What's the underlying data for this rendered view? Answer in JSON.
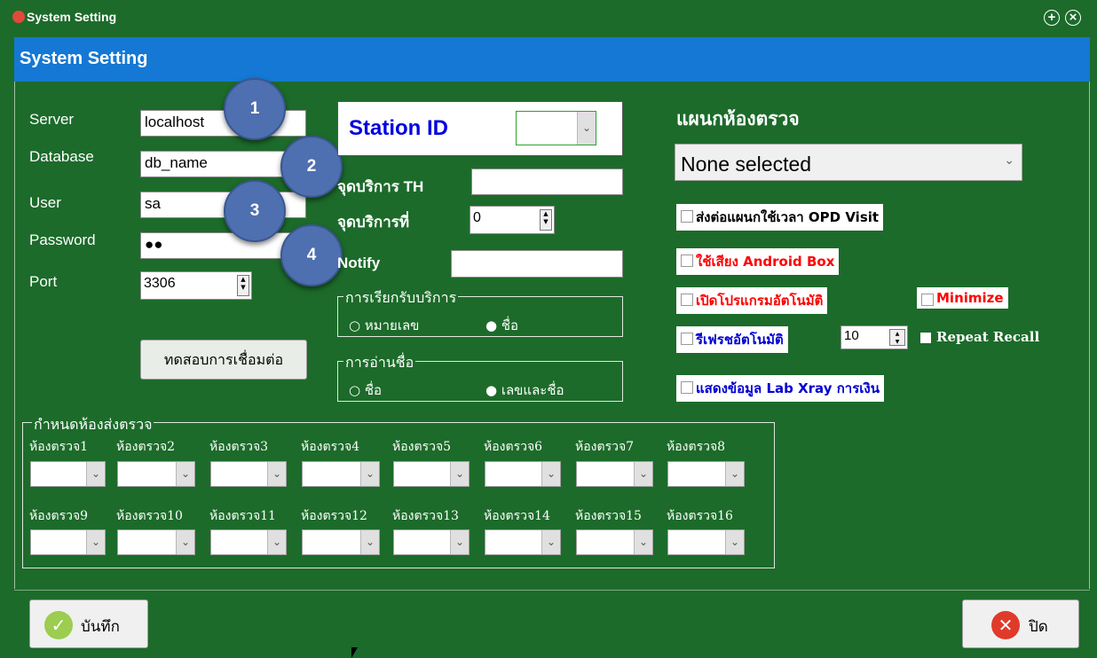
{
  "window": {
    "title": "System Setting"
  },
  "header": {
    "title": "System Setting"
  },
  "connection": {
    "server_label": "Server",
    "server_value": "localhost",
    "database_label": "Database",
    "database_value": "db_name",
    "user_label": "User",
    "user_value": "sa",
    "password_label": "Password",
    "password_value": "●●",
    "port_label": "Port",
    "port_value": "3306",
    "test_button": "ทดสอบการเชื่อมต่อ"
  },
  "markers": [
    "1",
    "2",
    "3",
    "4"
  ],
  "station": {
    "station_id_label": "Station ID",
    "service_point_th_label": "จุดบริการ TH",
    "service_point_no_label": "จุดบริการที่",
    "service_point_no_value": "0",
    "notify_label": "Notify"
  },
  "call_service": {
    "caption": "การเรียกรับบริการ",
    "option1": "หมายเลข",
    "option2": "ชื่อ"
  },
  "name_reading": {
    "caption": "การอ่านชื่อ",
    "option1": "ชื่อ",
    "option2": "เลขและชื่อ"
  },
  "department": {
    "label": "แผนกห้องตรวจ",
    "selected": "None selected"
  },
  "options": {
    "opd_visit": "ส่งต่อแผนกใช้เวลา OPD Visit",
    "android_box": "ใช้เสียง Android Box",
    "auto_open": "เปิดโปรแกรมอัตโนมัติ",
    "minimize": "Minimize",
    "auto_refresh": "รีเฟรชอัตโนมัติ",
    "refresh_value": "10",
    "repeat_recall": "Repeat Recall",
    "lab_xray": "แสดงข้อมูล Lab Xray การเงิน"
  },
  "colors": {
    "opd_visit": "#000000",
    "android_box": "#ff0000",
    "auto_open": "#ff0000",
    "minimize": "#ff0000",
    "auto_refresh": "#0000d0",
    "lab_xray": "#0000d0"
  },
  "rooms": {
    "caption": "กำหนดห้องส่งตรวจ",
    "labels": [
      "ห้องตรวจ1",
      "ห้องตรวจ2",
      "ห้องตรวจ3",
      "ห้องตรวจ4",
      "ห้องตรวจ5",
      "ห้องตรวจ6",
      "ห้องตรวจ7",
      "ห้องตรวจ8",
      "ห้องตรวจ9",
      "ห้องตรวจ10",
      "ห้องตรวจ11",
      "ห้องตรวจ12",
      "ห้องตรวจ13",
      "ห้องตรวจ14",
      "ห้องตรวจ15",
      "ห้องตรวจ16"
    ]
  },
  "footer": {
    "save": "บันทึก",
    "close": "ปิด"
  }
}
